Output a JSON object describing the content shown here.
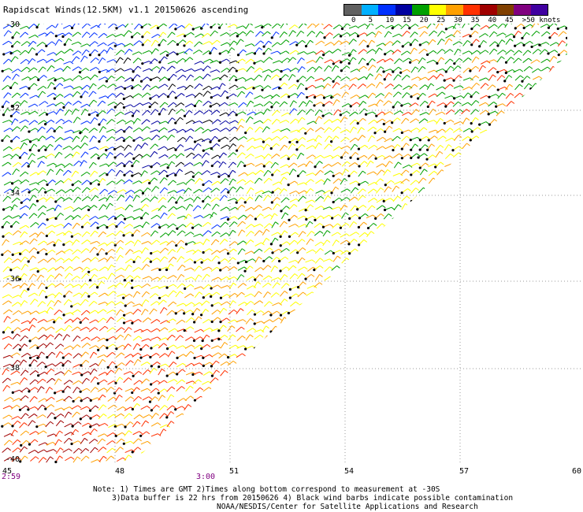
{
  "title": "Rapidscat Winds(12.5KM) v1.1 20150626 ascending",
  "legend": {
    "labels": [
      "0",
      "5",
      "10",
      "15",
      "20",
      "25",
      "30",
      "35",
      "40",
      "45",
      ">50 knots"
    ],
    "colors": [
      "#606060",
      "#00b0ff",
      "#0030ff",
      "#0000a0",
      "#00a000",
      "#ffff00",
      "#ffa000",
      "#ff3000",
      "#a00000",
      "#804000",
      "#800080",
      "#4000a0"
    ]
  },
  "latitudes": [
    "-30",
    "-32",
    "-34",
    "-36",
    "-38",
    "-40"
  ],
  "longitudes": [
    "45",
    "48",
    "51",
    "54",
    "57",
    "60"
  ],
  "times": [
    "2:59",
    "3:00"
  ],
  "note": {
    "line1": "Note: 1) Times are GMT 2)Times along bottom correspond to measurement at -30S",
    "line2": "3)Data buffer is 22 hrs from 20150626 4) Black wind barbs indicate possible contamination",
    "line3": "NOAA/NESDIS/Center for Satellite Applications and Research"
  }
}
